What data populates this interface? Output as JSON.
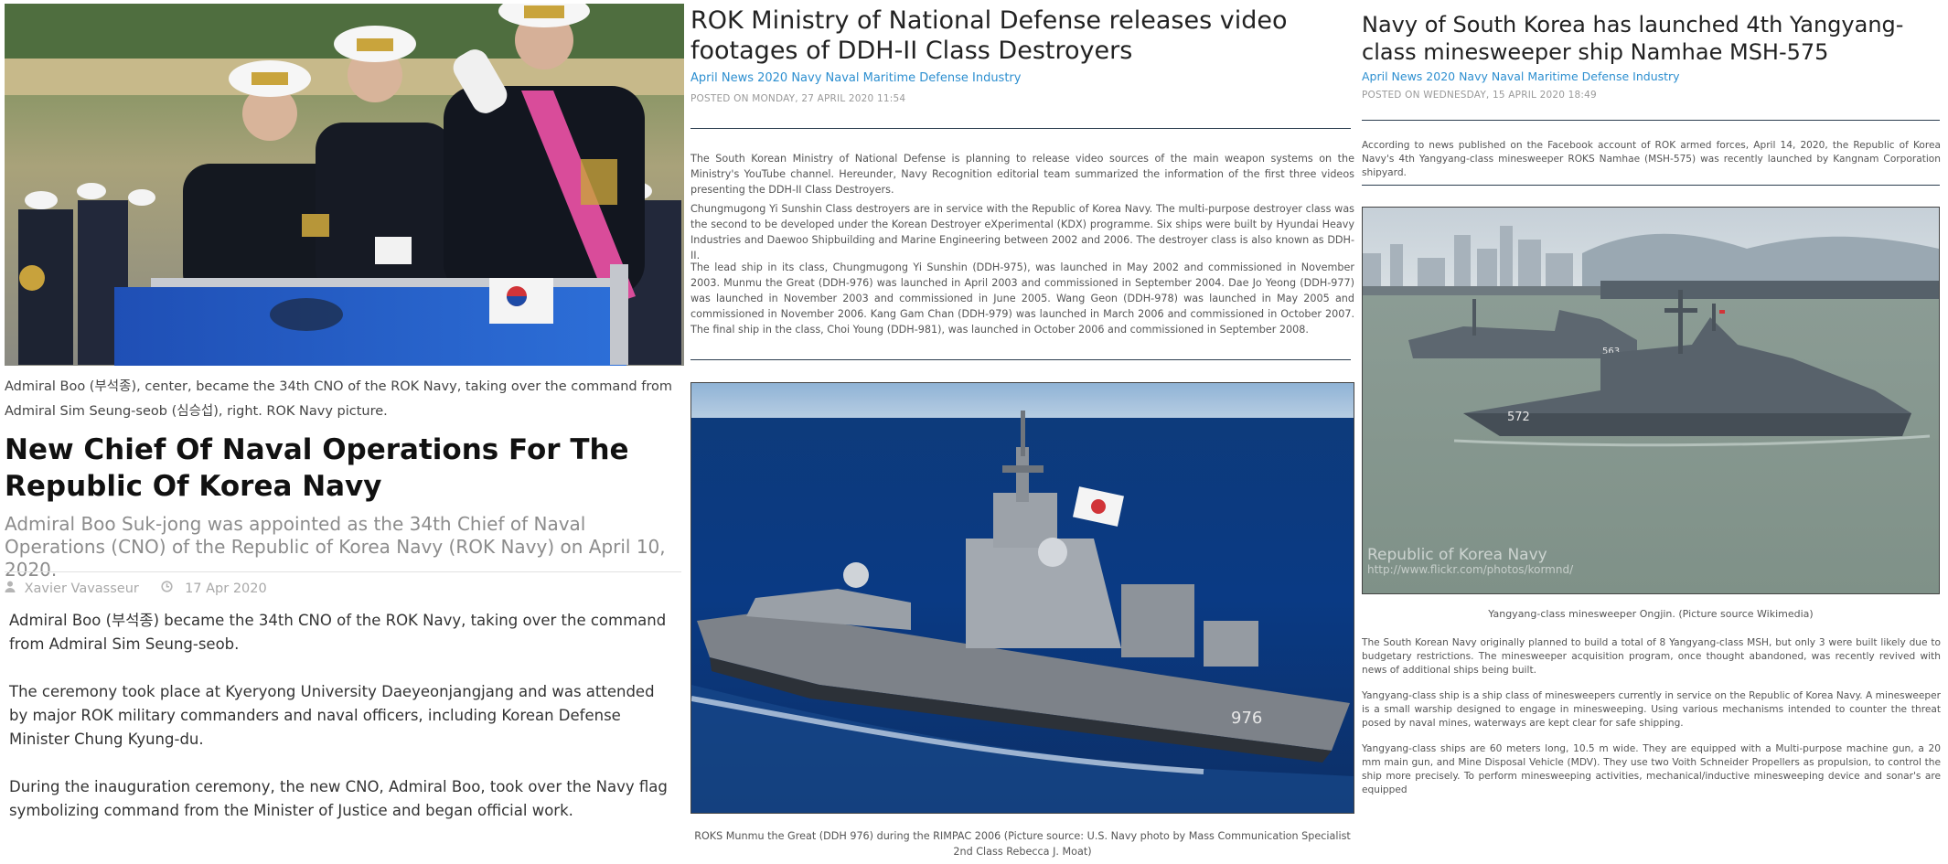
{
  "article1": {
    "photo_alt": "Admirals saluting from a vehicle during ceremony",
    "caption": "Admiral Boo (부석종), center, became the 34th CNO of the ROK Navy, taking over the command from Admiral Sim Seung-seob (심승섭), right. ROK Navy picture.",
    "title": "New Chief Of Naval Operations For The Republic Of Korea Navy",
    "subtitle": "Admiral Boo Suk-jong was appointed as the 34th Chief of Naval Operations (CNO) of the Republic of Korea Navy (ROK Navy) on April 10, 2020.",
    "author": "Xavier Vavasseur",
    "date": "17 Apr 2020",
    "paragraphs": [
      "Admiral Boo (부석종) became the 34th CNO of the ROK Navy, taking over the command from Admiral Sim Seung-seob.",
      "The ceremony took place at Kyeryong University Daeyeonjangjang and was attended by major ROK military commanders and naval officers, including Korean Defense Minister Chung Kyung-du.",
      "During the inauguration ceremony, the new CNO, Admiral Boo, took over the Navy flag symbolizing command from the Minister of Justice and began official work."
    ]
  },
  "article2": {
    "title": "ROK Ministry of National Defense releases video footages of DDH-II Class Destroyers",
    "tags": "April News 2020 Navy Naval Maritime Defense Industry",
    "posted": "POSTED ON MONDAY, 27 APRIL 2020 11:54",
    "intro": "The South Korean Ministry of National Defense is planning to release video sources of the main weapon systems on the Ministry's YouTube channel. Hereunder, Navy Recognition editorial team summarized the information of the first three videos presenting the DDH-II Class Destroyers.",
    "paragraphs": [
      "Chungmugong Yi Sunshin Class destroyers are in service with the Republic of Korea Navy. The multi-purpose destroyer class was the second to be developed under the Korean Destroyer eXperimental (KDX) programme. Six ships were built by Hyundai Heavy Industries and Daewoo Shipbuilding and Marine Engineering between 2002 and 2006. The destroyer class is also known as DDH-II.",
      "The lead ship in its class, Chungmugong Yi Sunshin (DDH-975), was launched in May 2002 and commissioned in November 2003. Munmu the Great (DDH-976) was launched in April 2003 and commissioned in September 2004. Dae Jo Yeong (DDH-977) was launched in November 2003 and commissioned in June 2005. Wang Geon (DDH-978) was launched in May 2005 and commissioned in November 2006. Kang Gam Chan (DDH-979) was launched in March 2006 and commissioned in October 2007. The final ship in the class, Choi Young (DDH-981), was launched in October 2006 and commissioned in September 2008."
    ],
    "photo_alt": "Destroyer at sea",
    "hull_number": "976",
    "caption": "ROKS Munmu the Great (DDH 976) during the RIMPAC 2006 (Picture source: U.S. Navy photo by Mass Communication Specialist 2nd Class Rebecca J. Moat)"
  },
  "article3": {
    "title": "Navy of South Korea has launched 4th Yangyang-class minesweeper ship Namhae MSH-575",
    "tags": "April News 2020 Navy Naval Maritime Defense Industry",
    "posted": "POSTED ON WEDNESDAY, 15 APRIL 2020 18:49",
    "intro": "According to news published on the Facebook account of ROK armed forces, April 14, 2020, the Republic of Korea Navy's 4th Yangyang-class minesweeper ROKS Namhae (MSH-575) was recently launched by Kangnam Corporation shipyard.",
    "photo_alt": "Two minesweepers in harbor",
    "hull_back": "563",
    "hull_front": "572",
    "watermark_1": "Republic of Korea Navy",
    "watermark_2": "http://www.flickr.com/photos/kormnd/",
    "caption": "Yangyang-class minesweeper Ongjin. (Picture source Wikimedia)",
    "paragraphs": [
      "The South Korean Navy originally planned to build a total of 8 Yangyang-class MSH, but only 3 were built likely due to budgetary restrictions. The minesweeper acquisition program, once thought abandoned, was recently revived with news of additional ships being built.",
      "Yangyang-class ship is a ship class of minesweepers currently in service on the Republic of Korea Navy. A minesweeper is a small warship designed to engage in minesweeping. Using various mechanisms intended to counter the threat posed by naval mines, waterways are kept clear for safe shipping.",
      "Yangyang-class ships are 60 meters long, 10.5 m wide. They are equipped with a Multi-purpose machine gun, a 20 mm main gun, and Mine Disposal Vehicle (MDV). They use two Voith Schneider Propellers as propulsion, to control the ship more precisely. To perform minesweeping activities, mechanical/inductive minesweeping device and sonar's are equipped"
    ]
  },
  "colors": {
    "link": "#2d8fd0",
    "rule": "#2c3e50",
    "muted": "#a8a8a8"
  }
}
